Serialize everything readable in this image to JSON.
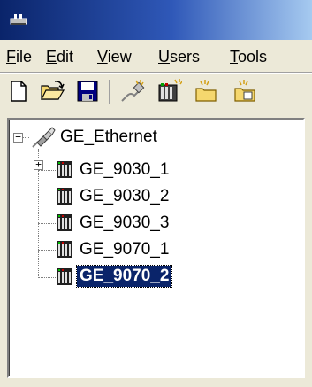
{
  "menu": {
    "file": {
      "prefix": "",
      "accel": "F",
      "rest": "ile"
    },
    "edit": {
      "prefix": "",
      "accel": "E",
      "rest": "dit"
    },
    "view": {
      "prefix": "",
      "accel": "V",
      "rest": "iew"
    },
    "users": {
      "prefix": "",
      "accel": "U",
      "rest": "sers"
    },
    "tools": {
      "prefix": "",
      "accel": "T",
      "rest": "ools"
    }
  },
  "toolbar": {
    "icons": [
      "new-document-icon",
      "open-folder-icon",
      "save-icon",
      "add-channel-icon",
      "add-device-icon",
      "new-group-icon",
      "add-item-icon"
    ]
  },
  "tree": {
    "root": {
      "label": "GE_Ethernet",
      "icon": "ethernet-channel-icon",
      "expanded": true
    },
    "devices": [
      {
        "label": "GE_9030_1",
        "icon": "plc-device-icon",
        "expander": "+"
      },
      {
        "label": "GE_9030_2",
        "icon": "plc-device-icon",
        "expander": ""
      },
      {
        "label": "GE_9030_3",
        "icon": "plc-device-icon",
        "expander": ""
      },
      {
        "label": "GE_9070_1",
        "icon": "plc-device-icon",
        "expander": ""
      },
      {
        "label": "GE_9070_2",
        "icon": "plc-device-icon",
        "expander": "",
        "selected": true
      }
    ],
    "root_expander": "−"
  },
  "colors": {
    "titlebar_start": "#0a246a",
    "titlebar_end": "#a6caf0",
    "window_bg": "#ece9d8",
    "selection_bg": "#0a246a"
  }
}
